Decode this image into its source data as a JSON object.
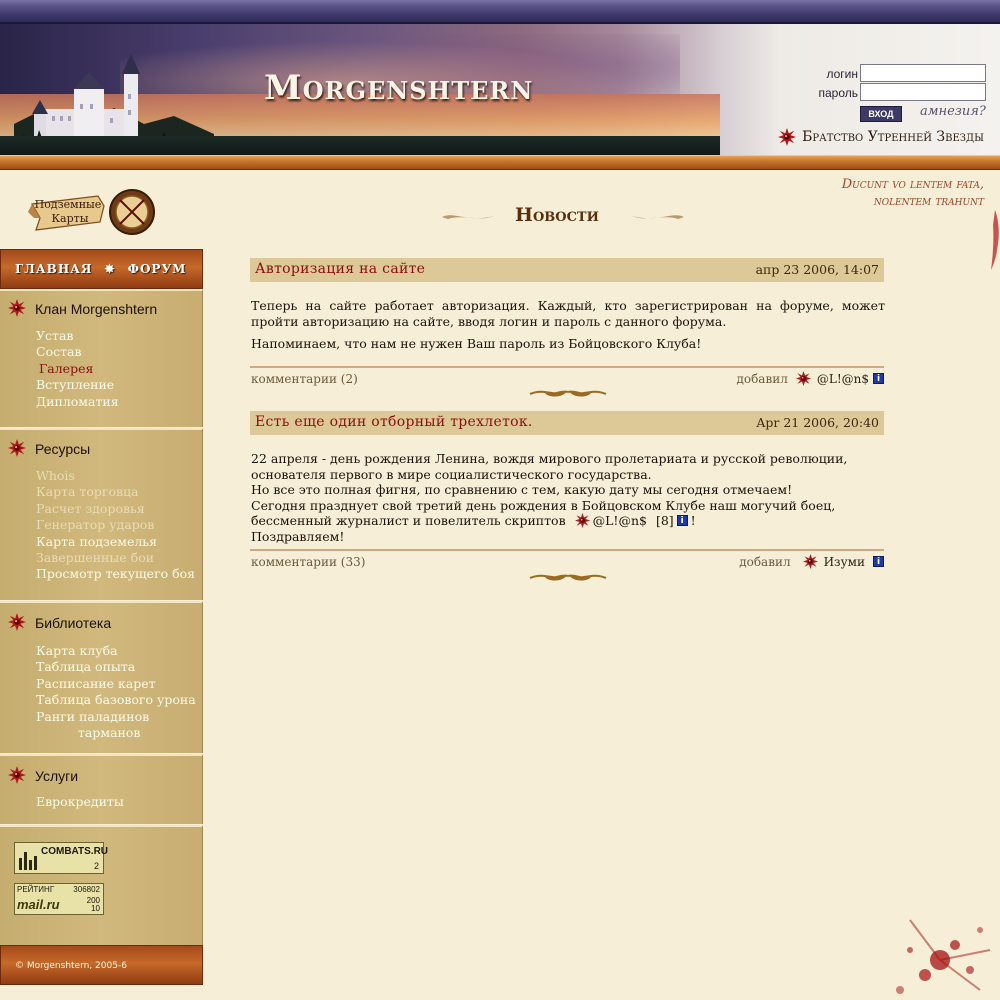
{
  "header": {
    "site_title": "Morgenshtern",
    "login_label": "логин",
    "password_label": "пароль",
    "login_button": "ВХОД",
    "amnesia_link": "амнезия?",
    "brotherhood": "Братство Утренней Звезды"
  },
  "sidebar": {
    "logo_text_line1": "Подземные",
    "logo_text_line2": "Карты",
    "nav_main": [
      "ГЛАВНАЯ",
      "ФОРУМ"
    ],
    "sections": [
      {
        "title": "Клан Morgenshtern",
        "items": [
          "Устав",
          "Состав",
          "Галерея",
          "Вступление",
          "Дипломатия"
        ]
      },
      {
        "title": "Ресурсы",
        "items": [
          "Whois",
          "Карта торговца",
          "Расчет здоровья",
          "Генератор ударов",
          "Карта подземелья",
          "Завершенные бои",
          "Просмотр текущего боя"
        ]
      },
      {
        "title": "Библиотека",
        "items": [
          "Карта клуба",
          "Таблица опыта",
          "Расписание карет",
          "Таблица базового урона",
          "Ранги паладинов",
          "тарманов"
        ]
      },
      {
        "title": "Услуги",
        "items": [
          "Еврокредиты"
        ]
      }
    ],
    "badge_combats": "COMBATS.RU",
    "badge_combats_num": "2",
    "badge_rating": "РЕЙТИНГ",
    "badge_rating_num": "306802",
    "badge_mail": "mail.ru",
    "badge_mail_v1": "200",
    "badge_mail_v2": "10",
    "footer": "© Morgenshtern, 2005-6"
  },
  "motto": {
    "line1": "Ducunt vo lentem fata,",
    "line2": "nolentem trahunt"
  },
  "page_heading": "Новости",
  "news": [
    {
      "title": "Авторизация на сайте",
      "date": "апр 23 2006, 14:07",
      "para1": "Теперь на сайте работает авторизация. Каждый, кто зарегистрирован на форуме, может пройти авторизацию на сайте, вводя логин и пароль с данного форума.",
      "para2": "Напоминаем, что нам не нужен Ваш пароль из Бойцовского Клуба!",
      "comments": "комментарии (2)",
      "added_by": "добавил",
      "author": "@L!@n$",
      "info": "i"
    },
    {
      "title": "Есть еще один отборный трехлеток.",
      "date": "Apr 21 2006, 20:40",
      "line1": "22 апреля - день рождения Ленина, вождя мирового пролетариата и русской революции,",
      "line2": "основателя первого в мире социалистического государства.",
      "line3": "Но все это полная фигня, по сравнению с тем, какую дату мы сегодня отмечаем!",
      "line4": "Сегодня празднует свой третий день рождения в Бойцовском Клубе наш могучий боец,",
      "line5_pre": "бессменный журналист и повелитель скриптов",
      "line5_nick": "@L!@n$",
      "line5_level": "[8]",
      "line5_post": "!",
      "line6": "Поздравляем!",
      "comments": "комментарии (33)",
      "added_by": "добавил",
      "author": "Изуми",
      "info": "i"
    }
  ],
  "colors": {
    "accent_red": "#8b0e0e",
    "sidebar_tan": "#c9b075",
    "nav_orange": "#b85a22",
    "header_band": "#3a3566"
  }
}
